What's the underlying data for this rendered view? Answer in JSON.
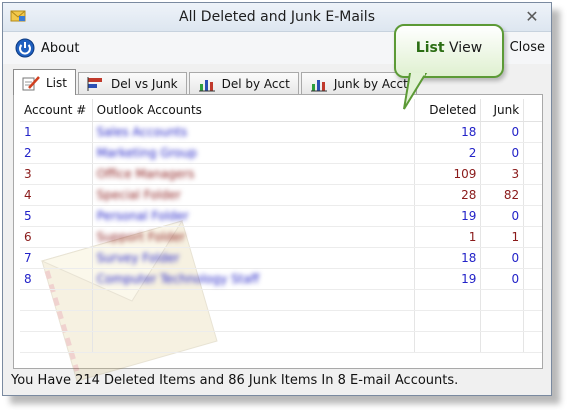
{
  "window": {
    "title": "All Deleted and Junk E-Mails",
    "close_glyph": "✕"
  },
  "toolbar": {
    "about_label": "About",
    "close_label": "Close"
  },
  "callout": {
    "bold": "List",
    "rest": " View"
  },
  "tabs": [
    {
      "label": "List",
      "icon": "checklist-pencil-icon",
      "active": true
    },
    {
      "label": "Del vs Junk",
      "icon": "bar-chart-icon",
      "active": false
    },
    {
      "label": "Del by Acct",
      "icon": "column-chart-icon",
      "active": false
    },
    {
      "label": "Junk by Acct",
      "icon": "column-chart-icon",
      "active": false
    }
  ],
  "table": {
    "headers": {
      "account": "Account #",
      "name": "Outlook Accounts",
      "deleted": "Deleted",
      "junk": "Junk"
    },
    "rows": [
      {
        "account": "1",
        "name": "Sales Accounts",
        "deleted": "18",
        "junk": "0"
      },
      {
        "account": "2",
        "name": "Marketing Group",
        "deleted": "2",
        "junk": "0"
      },
      {
        "account": "3",
        "name": "Office Managers",
        "deleted": "109",
        "junk": "3"
      },
      {
        "account": "4",
        "name": "Special Folder",
        "deleted": "28",
        "junk": "82"
      },
      {
        "account": "5",
        "name": "Personal Folder",
        "deleted": "19",
        "junk": "0"
      },
      {
        "account": "6",
        "name": "Support Folder",
        "deleted": "1",
        "junk": "1"
      },
      {
        "account": "7",
        "name": "Survey Folder",
        "deleted": "18",
        "junk": "0"
      },
      {
        "account": "8",
        "name": "Computer Technology Staff",
        "deleted": "19",
        "junk": "0"
      }
    ]
  },
  "status": {
    "text": "You Have 214 Deleted Items and 86 Junk Items In 8 E-mail Accounts."
  },
  "colors": {
    "row_blue": "#2323c8",
    "row_red": "#8a1a1a",
    "callout_border": "#5c9a36"
  }
}
